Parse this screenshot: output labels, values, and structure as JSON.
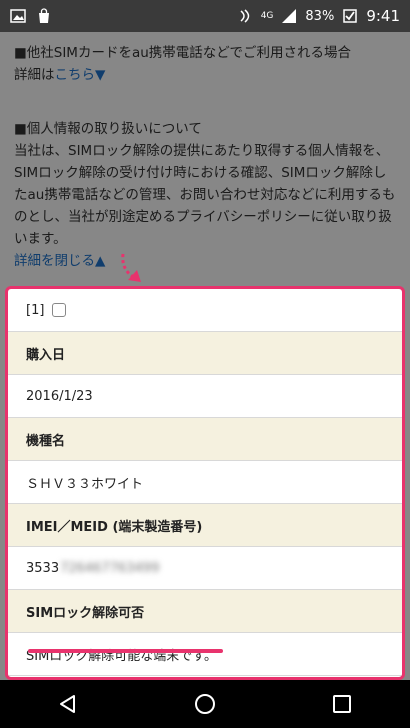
{
  "status": {
    "network": "4G",
    "battery": "83%",
    "time": "9:41"
  },
  "notice": {
    "line1": "■他社SIMカードをau携帯電話などでご利用される場合",
    "details_prefix": "詳細は",
    "details_link": "こちら▼"
  },
  "privacy": {
    "heading": "■個人情報の取り扱いについて",
    "body": "当社は、SIMロック解除の提供にあたり取得する個人情報を、SIMロック解除の受け付け時における確認、SIMロック解除したau携帯電話などの管理、お問い合わせ対応などに利用するものとし、当社が別途定めるプライバシーポリシーに従い取り扱います。",
    "close_link": "詳細を閉じる▲"
  },
  "table": {
    "index_label": "[1]",
    "purchase_date_label": "購入日",
    "purchase_date_value": "2016/1/23",
    "model_label": "機種名",
    "model_value": "ＳＨＶ３３ホワイト",
    "imei_label": "IMEI／MEID (端末製造番号)",
    "imei_visible": "3533",
    "imei_blurred": "726467763499",
    "sim_status_label": "SIMロック解除可否",
    "sim_status_value": "SIMロック解除可能な端末です。"
  },
  "colors": {
    "highlight": "#e8336d",
    "link": "#1a5fa8",
    "table_header_bg": "#f5f1df"
  }
}
